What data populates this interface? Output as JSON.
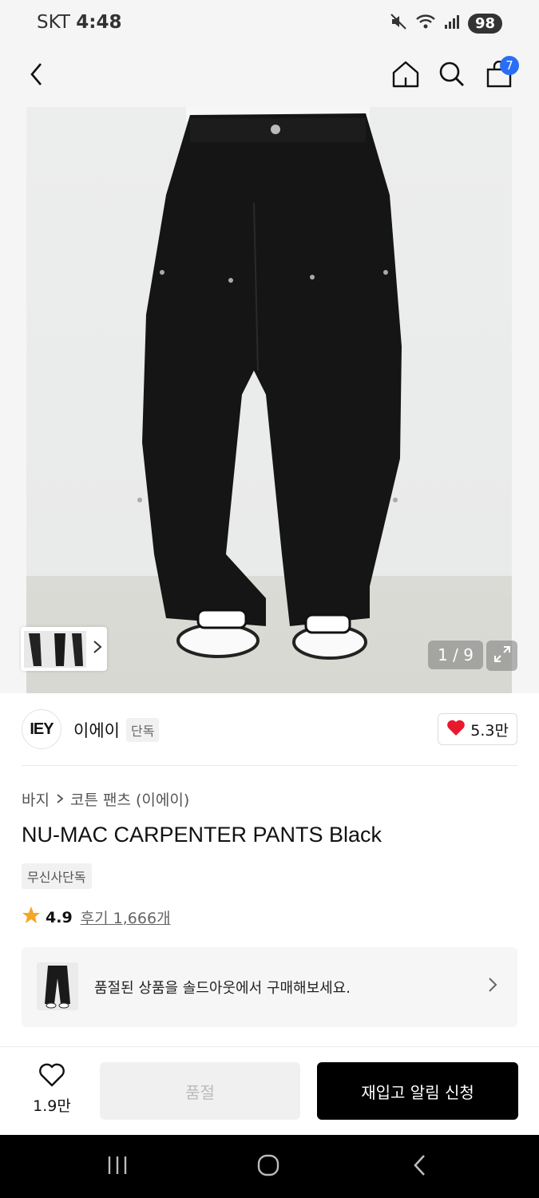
{
  "status_bar": {
    "carrier": "SKT",
    "time": "4:48",
    "battery": "98"
  },
  "nav": {
    "cart_count": "7"
  },
  "gallery": {
    "counter": "1 / 9"
  },
  "brand": {
    "logo_text": "IEY",
    "name": "이에이",
    "tag": "단독",
    "likes": "5.3만"
  },
  "breadcrumb": {
    "category": "바지",
    "subcategory": "코튼 팬츠 (이에이)"
  },
  "product": {
    "title": "NU-MAC CARPENTER PANTS Black",
    "badge": "무신사단독",
    "rating": "4.9",
    "review_link": "후기 1,666개"
  },
  "soldout_banner": {
    "text": "품절된 상품을 솔드아웃에서 구매해보세요."
  },
  "bottom_bar": {
    "wish_count": "1.9만",
    "soldout_label": "품절",
    "restock_label": "재입고 알림 신청"
  },
  "colors": {
    "accent_blue": "#2b6ef6",
    "heart_red": "#e8192c",
    "star": "#f5a623",
    "primary_black": "#000000"
  }
}
